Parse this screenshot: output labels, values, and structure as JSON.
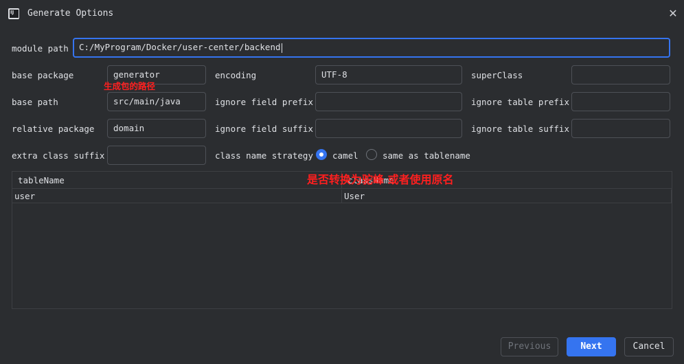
{
  "window": {
    "title": "Generate Options",
    "app_icon_text": "IJ"
  },
  "form": {
    "module_path": {
      "label": "module path",
      "value": "C:/MyProgram/Docker/user-center/backend"
    },
    "base_package": {
      "label": "base package",
      "value": "generator"
    },
    "encoding": {
      "label": "encoding",
      "value": "UTF-8"
    },
    "super_class": {
      "label": "superClass",
      "value": ""
    },
    "base_path": {
      "label": "base path",
      "value": "src/main/java"
    },
    "ignore_field_prefix": {
      "label": "ignore field prefix",
      "value": ""
    },
    "ignore_table_prefix": {
      "label": "ignore table prefix",
      "value": ""
    },
    "relative_package": {
      "label": "relative package",
      "value": "domain"
    },
    "ignore_field_suffix": {
      "label": "ignore field suffix",
      "value": ""
    },
    "ignore_table_suffix": {
      "label": "ignore table suffix",
      "value": ""
    },
    "extra_class_suffix": {
      "label": "extra class suffix",
      "value": ""
    },
    "class_name_strategy": {
      "label": "class name strategy",
      "options": [
        {
          "label": "camel",
          "selected": true
        },
        {
          "label": "same as tablename",
          "selected": false
        }
      ]
    }
  },
  "annotations": {
    "package_path_note": "生成包的路径",
    "strategy_note": "是否转换为驼峰 或者使用原名"
  },
  "table": {
    "columns": [
      "tableName",
      "className"
    ],
    "rows": [
      [
        "user",
        "User"
      ]
    ]
  },
  "buttons": {
    "previous": "Previous",
    "next": "Next",
    "cancel": "Cancel"
  },
  "colors": {
    "accent": "#3574f0",
    "background": "#2b2d30",
    "annotation": "#ff1f1f"
  },
  "icons": {
    "app": "intellij-icon",
    "close": "close-icon"
  }
}
